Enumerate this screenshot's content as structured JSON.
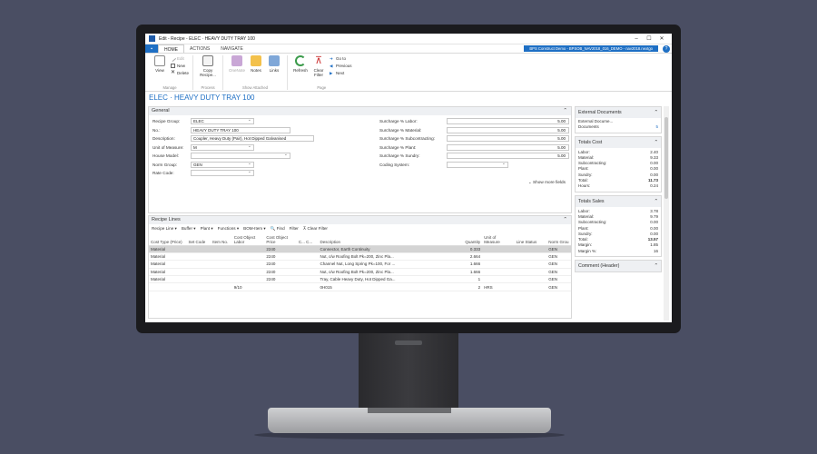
{
  "window": {
    "title": "Edit - Recipe - ELEC · HEAVY DUTY TRAY 100",
    "minimize": "–",
    "maximize": "☐",
    "close": "✕"
  },
  "ribbon": {
    "tabs": [
      "HOME",
      "ACTIONS",
      "NAVIGATE"
    ],
    "file_tab": "▪",
    "company": "BPS Construct Demo - BPSOB_NAV2018_016_DEMO - nav2018.nextgo",
    "help": "?",
    "manage": {
      "view": "View",
      "edit": "Edit",
      "new": "New",
      "delete": "Delete",
      "label": "Manage"
    },
    "process": {
      "copy": "Copy Recipe...",
      "label": "Process"
    },
    "show_attached": {
      "onenote": "OneNote",
      "notes": "Notes",
      "links": "Links",
      "label": "Show Attached"
    },
    "page": {
      "refresh": "Refresh",
      "clear_filter": "Clear Filter",
      "goto": "Go to",
      "previous": "Previous",
      "next": "Next",
      "label": "Page"
    }
  },
  "page_title": "ELEC · HEAVY DUTY TRAY 100",
  "general": {
    "title": "General",
    "left": [
      {
        "label": "Recipe Group:",
        "value": "ELEC",
        "type": "dd"
      },
      {
        "label": "No.:",
        "value": "HEAVY DUTY TRAY 100",
        "type": "text"
      },
      {
        "label": "Description:",
        "value": "Coupler, Heavy Duty (Pair), Hot Dipped Galvanised",
        "type": "text"
      },
      {
        "label": "Unit of Measure:",
        "value": "M",
        "type": "dd"
      },
      {
        "label": "House Model:",
        "value": "",
        "type": "dd"
      },
      {
        "label": "Norm Group:",
        "value": "GEN",
        "type": "dd"
      },
      {
        "label": "Rate Code:",
        "value": "",
        "type": "dd"
      }
    ],
    "right": [
      {
        "label": "Surcharge % Labor:",
        "value": "5.00"
      },
      {
        "label": "Surcharge % Material:",
        "value": "5.00"
      },
      {
        "label": "Surcharge % Subcontracting:",
        "value": "5.00"
      },
      {
        "label": "Surcharge % Plant:",
        "value": "5.00"
      },
      {
        "label": "Surcharge % Sundry:",
        "value": "5.00"
      },
      {
        "label": "Coding System:",
        "value": ""
      }
    ],
    "show_more": "⌄  Show more fields"
  },
  "recipe_lines": {
    "title": "Recipe Lines",
    "toolbar": [
      "Recipe Line ▾",
      "Buffer ▾",
      "Plant ▾",
      "Functions ▾",
      "BOM-Item ▾",
      "🔍 Find",
      "Filter",
      "⊼ Clear Filter"
    ],
    "columns": [
      "Cost Type (Price)",
      "Set Code",
      "Item No.",
      "Cost Object Labor",
      "Cost Object Price",
      "C... C...",
      "Description",
      "Quantity",
      "Unit of Measure",
      "Line Status",
      "Norm Grou"
    ],
    "rows": [
      [
        "Material",
        "",
        "",
        "",
        "2240",
        "",
        "Connector, Earth Continuity",
        "0.333",
        "",
        "",
        "GEN"
      ],
      [
        "Material",
        "",
        "",
        "",
        "2240",
        "",
        "Nut, c/w Roofing Bolt Pk=200, Zinc Pla...",
        "2.664",
        "",
        "",
        "GEN"
      ],
      [
        "Material",
        "",
        "",
        "",
        "2240",
        "",
        "Channel Nut, Long Spring Pk=100, For ...",
        "1.666",
        "",
        "",
        "GEN"
      ],
      [
        "Material",
        "",
        "",
        "",
        "2240",
        "",
        "Nut, c/w Roofing Bolt Pk=200, Zinc Pla...",
        "1.666",
        "",
        "",
        "GEN"
      ],
      [
        "Material",
        "",
        "",
        "",
        "2240",
        "",
        "Tray, Cable Heavy Duty, Hot Dipped Ga...",
        "1",
        "",
        "",
        "GEN"
      ],
      [
        "",
        "",
        "",
        "9/10",
        "",
        "",
        "0H015",
        "2",
        "HRS",
        "",
        "GEN"
      ]
    ]
  },
  "factbox": {
    "external_docs": {
      "title": "External Documents",
      "rows": [
        [
          "External Docume...",
          ""
        ],
        [
          "Documents",
          "5"
        ]
      ]
    },
    "totals_cost": {
      "title": "Totals Cost",
      "rows": [
        [
          "Labor:",
          "2.40"
        ],
        [
          "Material:",
          "9.33"
        ],
        [
          "Subcontracting:",
          "0.00"
        ],
        [
          "Plant:",
          "0.00"
        ],
        [
          "Sundry:",
          "0.00"
        ],
        [
          "Total:",
          "11.73"
        ],
        [
          "Hours:",
          "0.24"
        ]
      ]
    },
    "totals_sales": {
      "title": "Totals Sales",
      "rows": [
        [
          "Labor:",
          "3.78"
        ],
        [
          "Material:",
          "9.79"
        ],
        [
          "Subcontracting:",
          "0.00"
        ],
        [
          "Plant:",
          "0.00"
        ],
        [
          "Sundry:",
          "0.00"
        ],
        [
          "Total:",
          "13.57"
        ],
        [
          "Margin:",
          "1.85"
        ],
        [
          "Margin %:",
          "16"
        ]
      ]
    },
    "comment": {
      "title": "Comment (Header)"
    }
  },
  "colors": {
    "accent": "#1e6fc4",
    "header_bg": "#eef0f3",
    "selected_row": "#d4d4d4"
  }
}
